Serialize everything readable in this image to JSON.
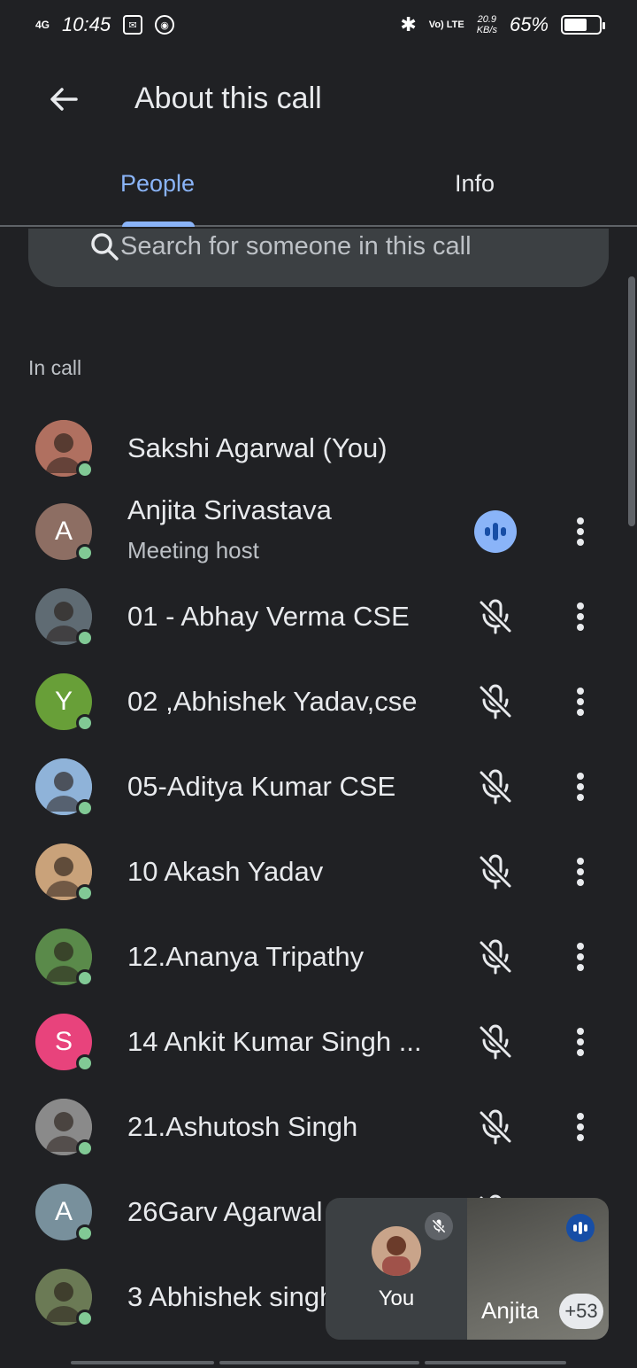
{
  "status_bar": {
    "network": "4G",
    "time": "10:45",
    "volte": "Vo) LTE",
    "speed_value": "20.9",
    "speed_unit": "KB/s",
    "battery": "65%",
    "battery_level": 0.65
  },
  "app_bar": {
    "title": "About this call"
  },
  "tabs": [
    {
      "label": "People",
      "selected": true
    },
    {
      "label": "Info",
      "selected": false
    }
  ],
  "search": {
    "placeholder": "Search for someone in this call"
  },
  "section": {
    "in_call": "In call"
  },
  "participants": [
    {
      "name": "Sakshi Agarwal (You)",
      "subtitle": "",
      "avatar_type": "photo",
      "avatar_color": "#b07060",
      "state": "none"
    },
    {
      "name": "Anjita Srivastava",
      "subtitle": "Meeting host",
      "avatar_type": "letter",
      "letter": "A",
      "avatar_color": "#8d6e63",
      "state": "talking"
    },
    {
      "name": "01 - Abhay Verma CSE",
      "subtitle": "",
      "avatar_type": "photo",
      "avatar_color": "#5f6b73",
      "state": "muted"
    },
    {
      "name": "02 ,Abhishek Yadav,cse",
      "subtitle": "",
      "avatar_type": "letter",
      "letter": "Y",
      "avatar_color": "#689f38",
      "state": "muted"
    },
    {
      "name": "05-Aditya Kumar CSE",
      "subtitle": "",
      "avatar_type": "photo",
      "avatar_color": "#8fb3d9",
      "state": "muted"
    },
    {
      "name": "10 Akash Yadav",
      "subtitle": "",
      "avatar_type": "photo",
      "avatar_color": "#c9a27a",
      "state": "muted"
    },
    {
      "name": "12.Ananya Tripathy",
      "subtitle": "",
      "avatar_type": "photo",
      "avatar_color": "#5a8a4a",
      "state": "muted"
    },
    {
      "name": "14 Ankit Kumar Singh ...",
      "subtitle": "",
      "avatar_type": "letter",
      "letter": "S",
      "avatar_color": "#e8437c",
      "state": "muted"
    },
    {
      "name": "21.Ashutosh Singh",
      "subtitle": "",
      "avatar_type": "photo",
      "avatar_color": "#8a8a8a",
      "state": "muted"
    },
    {
      "name": "26Garv Agarwal",
      "subtitle": "",
      "avatar_type": "letter",
      "letter": "A",
      "avatar_color": "#78909c",
      "state": "muted"
    },
    {
      "name": "3 Abhishek singh",
      "subtitle": "",
      "avatar_type": "photo",
      "avatar_color": "#6b7a55",
      "state": "muted"
    }
  ],
  "pip": {
    "self_label": "You",
    "other_label": "Anjita",
    "others_count": "+53"
  },
  "colors": {
    "background": "#202124",
    "accent": "#8ab4f8",
    "online": "#81c995"
  }
}
